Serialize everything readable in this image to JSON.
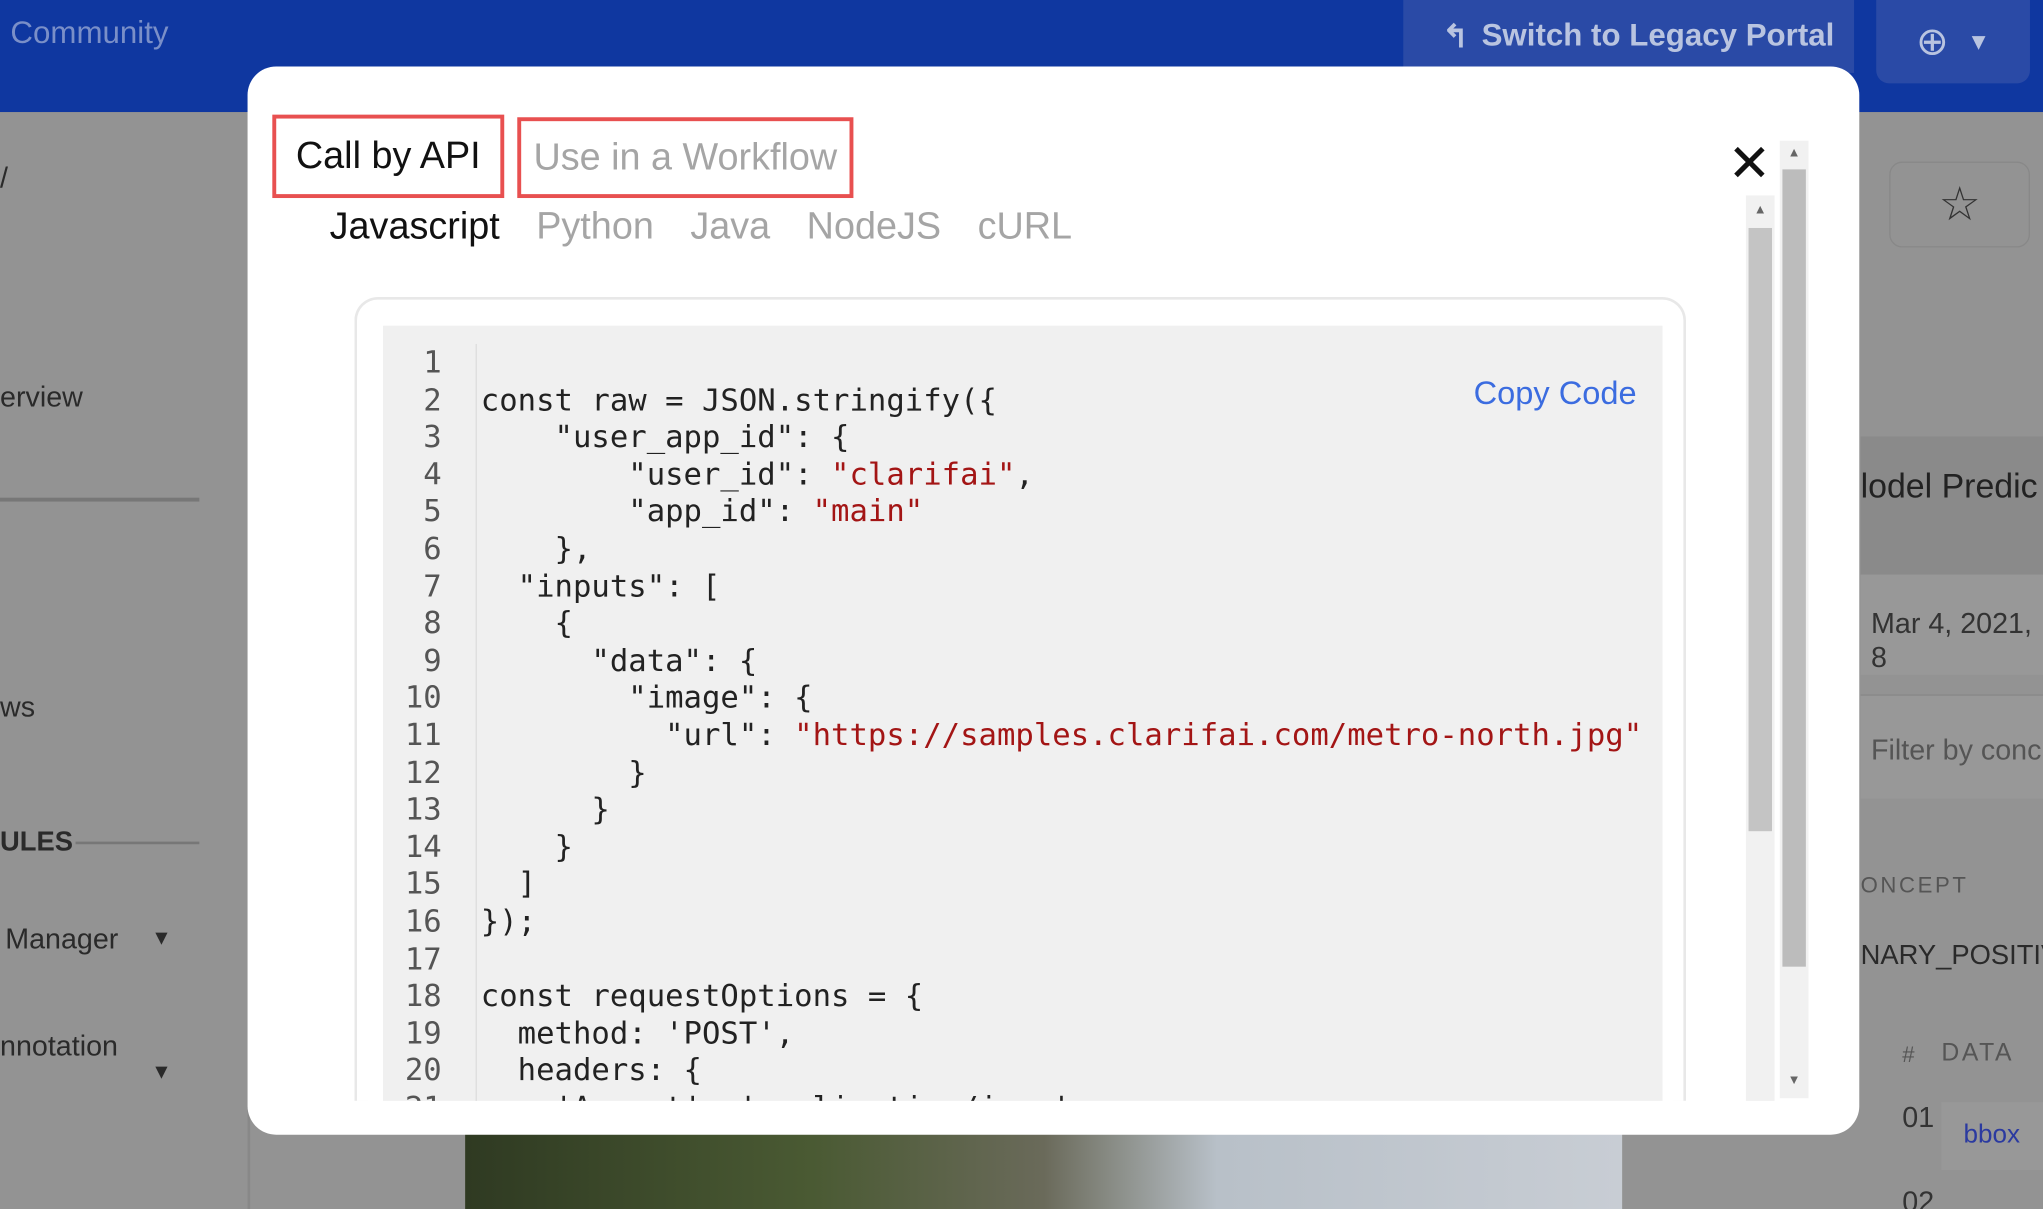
{
  "header": {
    "community": "Community",
    "legacy_button": "Switch to Legacy Portal",
    "legacy_icon": "undo-arrow-icon",
    "add_icon": "plus-circle-icon",
    "dropdown_icon": "caret-down-icon"
  },
  "sidebar": {
    "slash": "/",
    "overview": "erview",
    "workflows": "ws",
    "modules_heading": "ULES",
    "manager": "Manager",
    "annotation": "nnotation"
  },
  "right_panel": {
    "title": "lodel Predic",
    "date": "Mar 4, 2021, 8",
    "filter_placeholder": "Filter by conc",
    "concept_header": "ONCEPT",
    "concept_value": "NARY_POSITIV",
    "hash_header": "#",
    "data_header": "DATA",
    "row1_num": "01",
    "row1_value": "bbox",
    "row2_num": "02"
  },
  "modal": {
    "tabs": [
      {
        "label": "Call by API",
        "active": true
      },
      {
        "label": "Use in a Workflow",
        "active": false
      }
    ],
    "languages": [
      {
        "label": "Javascript",
        "active": true
      },
      {
        "label": "Python"
      },
      {
        "label": "Java"
      },
      {
        "label": "NodeJS"
      },
      {
        "label": "cURL"
      }
    ],
    "copy_label": "Copy Code",
    "code_lines": [
      [
        {
          "t": ""
        }
      ],
      [
        {
          "t": "const raw = JSON.stringify({"
        }
      ],
      [
        {
          "t": "    "
        },
        {
          "t": "\"user_app_id\": {"
        }
      ],
      [
        {
          "t": "        "
        },
        {
          "t": "\"user_id\": "
        },
        {
          "t": "\"clarifai\"",
          "s": 1
        },
        {
          "t": ","
        }
      ],
      [
        {
          "t": "        "
        },
        {
          "t": "\"app_id\": "
        },
        {
          "t": "\"main\"",
          "s": 1
        }
      ],
      [
        {
          "t": "    },"
        }
      ],
      [
        {
          "t": "  \"inputs\": ["
        }
      ],
      [
        {
          "t": "    {"
        }
      ],
      [
        {
          "t": "      \"data\": {"
        }
      ],
      [
        {
          "t": "        \"image\": {"
        }
      ],
      [
        {
          "t": "          \"url\": "
        },
        {
          "t": "\"https://samples.clarifai.com/metro-north.jpg\"",
          "s": 1
        }
      ],
      [
        {
          "t": "        }"
        }
      ],
      [
        {
          "t": "      }"
        }
      ],
      [
        {
          "t": "    }"
        }
      ],
      [
        {
          "t": "  ]"
        }
      ],
      [
        {
          "t": "});"
        }
      ],
      [
        {
          "t": ""
        }
      ],
      [
        {
          "t": "const requestOptions = {"
        }
      ],
      [
        {
          "t": "  method: 'POST',"
        }
      ],
      [
        {
          "t": "  headers: {"
        }
      ],
      [
        {
          "t": "    'Accept': 'application/json',"
        }
      ]
    ]
  },
  "colors": {
    "brand_blue": "#0f37a0",
    "highlight_border": "#e85050",
    "link": "#3b6ce0",
    "string": "#a31515"
  }
}
